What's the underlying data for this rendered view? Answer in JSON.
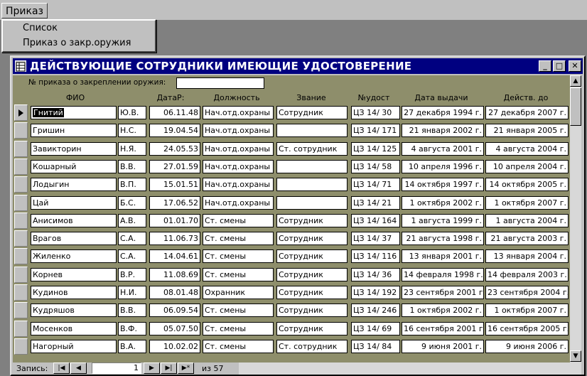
{
  "menubar": {
    "prikaz": "Приказ"
  },
  "dropdown": {
    "items": [
      "Список",
      "Приказ о закр.оружия"
    ]
  },
  "window": {
    "title": "ДЕЙСТВУЮЩИЕ СОТРУДНИКИ ИМЕЮЩИЕ УДОСТОВЕРЕНИЕ",
    "min_icon": "minimize-icon",
    "max_icon": "maximize-icon",
    "close_icon": "close-icon"
  },
  "form": {
    "order_label": "№ приказа о закреплении оружия:",
    "order_value": "",
    "headers": [
      "ФИО",
      "ДатаР:",
      "Должность",
      "Звание",
      "№удост",
      "Дата выдачи",
      "Действ. до"
    ]
  },
  "rows": [
    {
      "fio": "Гнитий",
      "init": "Ю.В.",
      "dob": "06.11.48",
      "pos": "Нач.отд.охраны",
      "rank": "Сотрудник",
      "cert": "ЦЗ 14/ 30",
      "issued": "27 декабря 1994 г.",
      "valid": "27 декабря 2007 г."
    },
    {
      "fio": "Гришин",
      "init": "Н.С.",
      "dob": "19.04.54",
      "pos": "Нач.отд.охраны",
      "rank": "",
      "cert": "ЦЗ 14/ 171",
      "issued": "21 января 2002 г.",
      "valid": "21 января 2005 г."
    },
    {
      "fio": "Завикторин",
      "init": "Н.Я.",
      "dob": "24.05.53",
      "pos": "Нач.отд.охраны",
      "rank": "Ст. сотрудник",
      "cert": "ЦЗ 14/ 125",
      "issued": "4 августа 2001 г.",
      "valid": "4 августа 2004 г."
    },
    {
      "fio": "Кошарный",
      "init": "В.В.",
      "dob": "27.01.59",
      "pos": "Нач.отд.охраны",
      "rank": "",
      "cert": "ЦЗ 14/ 58",
      "issued": "10 апреля 1996 г.",
      "valid": "10 апреля 2004 г."
    },
    {
      "fio": "Лодыгин",
      "init": "В.П.",
      "dob": "15.01.51",
      "pos": "Нач.отд.охраны",
      "rank": "",
      "cert": "ЦЗ 14/ 71",
      "issued": "14 октября 1997 г.",
      "valid": "14 октября 2005 г."
    },
    {
      "fio": "Цай",
      "init": "Б.С.",
      "dob": "17.06.52",
      "pos": "Нач.отд.охраны",
      "rank": "",
      "cert": "ЦЗ 14/ 21",
      "issued": "1 октября 2002 г.",
      "valid": "1 октября 2007 г."
    },
    {
      "fio": "Анисимов",
      "init": "А.В.",
      "dob": "01.01.70",
      "pos": "Ст. смены",
      "rank": "Сотрудник",
      "cert": "ЦЗ 14/ 164",
      "issued": "1 августа 1999 г.",
      "valid": "1 августа 2004 г."
    },
    {
      "fio": "Врагов",
      "init": "С.А.",
      "dob": "11.06.73",
      "pos": "Ст. смены",
      "rank": "Сотрудник",
      "cert": "ЦЗ 14/ 37",
      "issued": "21 августа 1998 г.",
      "valid": "21 августа 2003 г."
    },
    {
      "fio": "Жиленко",
      "init": "С.А.",
      "dob": "14.04.61",
      "pos": "Ст. смены",
      "rank": "Сотрудник",
      "cert": "ЦЗ 14/ 116",
      "issued": "13 января 2001 г.",
      "valid": "13 января 2004 г."
    },
    {
      "fio": "Корнев",
      "init": "В.Р.",
      "dob": "11.08.69",
      "pos": "Ст. смены",
      "rank": "Сотрудник",
      "cert": "ЦЗ 14/ 36",
      "issued": "14 февраля 1998 г.",
      "valid": "14 февраля 2003 г."
    },
    {
      "fio": "Кудинов",
      "init": "Н.И.",
      "dob": "08.01.48",
      "pos": "Охранник",
      "rank": "Сотрудник",
      "cert": "ЦЗ 14/ 192",
      "issued": "23 сентября 2001 г.",
      "valid": "23 сентября 2004 г."
    },
    {
      "fio": "Кудряшов",
      "init": "В.В.",
      "dob": "06.09.54",
      "pos": "Ст. смены",
      "rank": "Сотрудник",
      "cert": "ЦЗ 14/ 246",
      "issued": "1 октября 2002 г.",
      "valid": "1 октября 2007 г."
    },
    {
      "fio": "Мосенков",
      "init": "В.Ф.",
      "dob": "05.07.50",
      "pos": "Ст. смены",
      "rank": "Сотрудник",
      "cert": "ЦЗ 14/ 69",
      "issued": "16 сентября 2001 г.",
      "valid": "16 сентября 2005 г."
    },
    {
      "fio": "Нагорный",
      "init": "В.А.",
      "dob": "10.02.02",
      "pos": "Ст. смены",
      "rank": "Ст. сотрудник",
      "cert": "ЦЗ 14/ 84",
      "issued": "9 июня 2001 г.",
      "valid": "9 июня 2006 г."
    }
  ],
  "navbar": {
    "label": "Запись:",
    "current": "1",
    "of": "из",
    "total": "57"
  }
}
